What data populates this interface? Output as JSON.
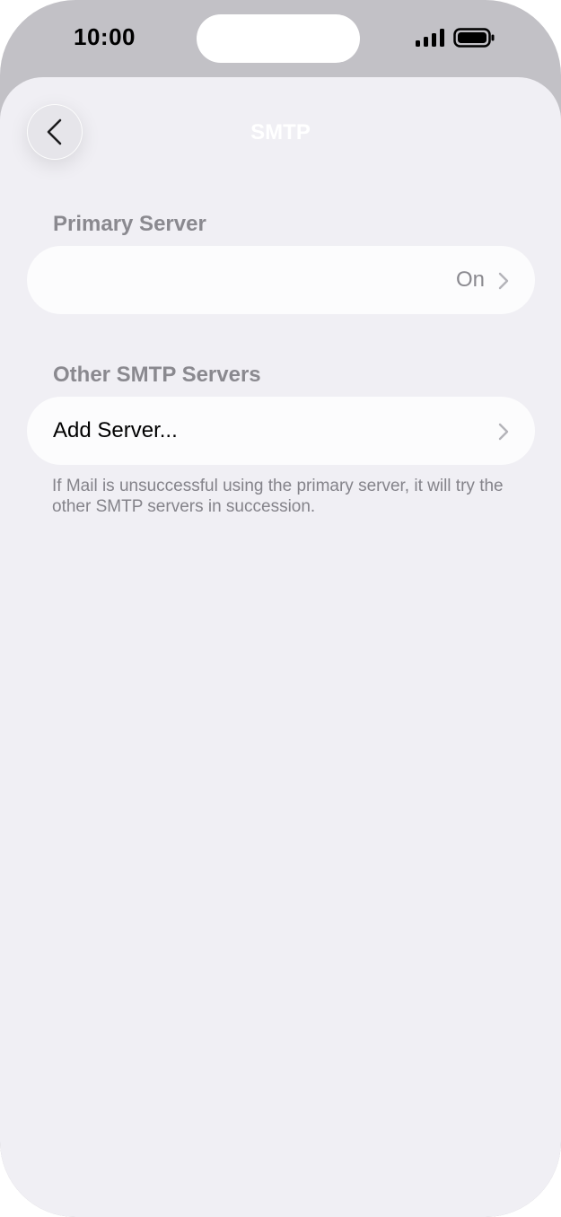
{
  "status_bar": {
    "time": "10:00",
    "signal_icon": "cellular-signal-icon",
    "battery_icon": "battery-full-icon"
  },
  "nav": {
    "back_icon": "chevron-left-icon",
    "title": "SMTP"
  },
  "primary_section": {
    "header": "Primary Server",
    "row": {
      "label": "",
      "value": "On",
      "icon": "chevron-right-icon"
    }
  },
  "other_section": {
    "header": "Other SMTP Servers",
    "row": {
      "label": "Add Server...",
      "icon": "chevron-right-icon"
    },
    "footer": "If Mail is unsuccessful using the primary server, it will try the other SMTP servers in succession."
  },
  "colors": {
    "background": "#f0eff4",
    "cell": "#fcfcfd",
    "secondary_text": "#8a898f",
    "bezel": "#c2c1c6"
  }
}
